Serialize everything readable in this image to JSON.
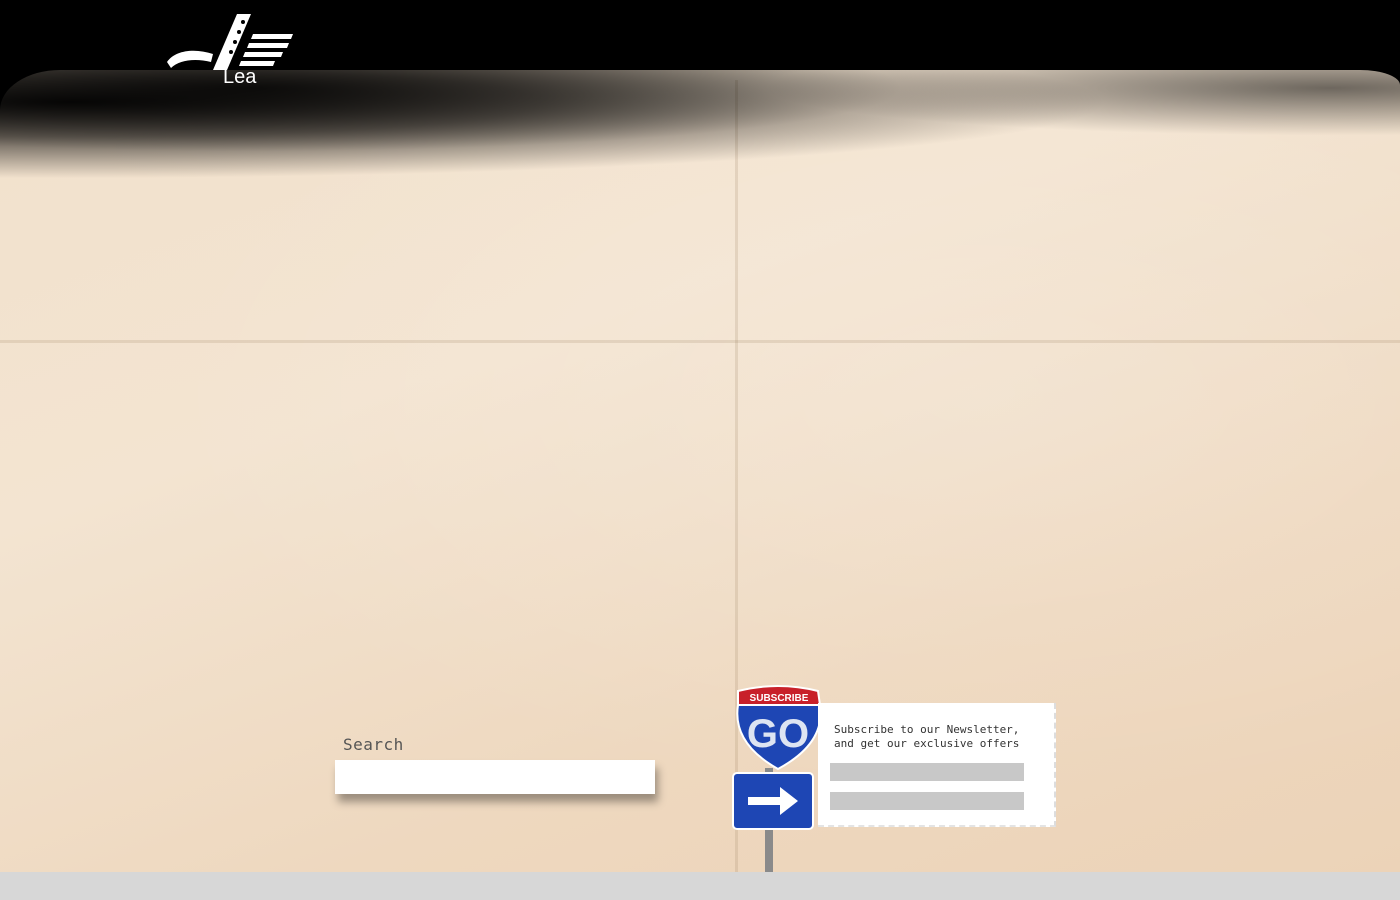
{
  "brand": {
    "logo_text": "Lea"
  },
  "search": {
    "label": "Search",
    "placeholder": ""
  },
  "newsletter": {
    "sign_top": "SUBSCRIBE",
    "sign_main": "GO",
    "text_line1": "Subscribe to our Newsletter,",
    "text_line2": "and get our exclusive offers",
    "field1_placeholder": "",
    "field2_placeholder": ""
  },
  "colors": {
    "topbar": "#000000",
    "paper": "#f2e1cc",
    "sign_blue": "#1e46b4",
    "sign_red": "#c8202a"
  }
}
